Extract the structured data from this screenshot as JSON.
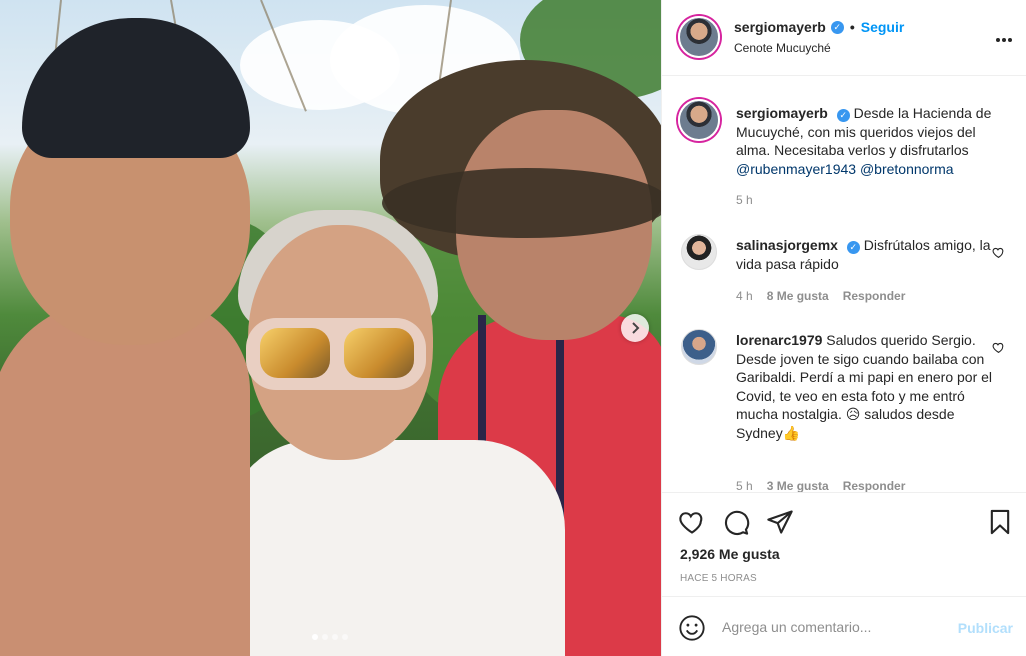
{
  "post": {
    "image_alt": "",
    "carousel": {
      "total": 4,
      "active": 0,
      "next_icon": "chevron-right-icon"
    }
  },
  "header": {
    "username": "sergiomayerb",
    "verified": true,
    "separator": "•",
    "follow_label": "Seguir",
    "location": "Cenote Mucuyché",
    "more_icon": "more-horizontal-icon"
  },
  "caption": {
    "username": "sergiomayerb",
    "text": "Desde la Hacienda de Mucuyché, con mis queridos viejos del alma. Necesitaba verlos y disfrutarlos",
    "mention1": "@rubenmayer1943",
    "mention2": "@bretonnorma",
    "time": "5 h"
  },
  "comments": [
    {
      "username": "salinasjorgemx",
      "verified": true,
      "text": "Disfrútalos amigo, la vida pasa rápido",
      "time": "4 h",
      "likes": "8 Me gusta",
      "reply": "Responder"
    },
    {
      "username": "lorenarc1979",
      "verified": false,
      "text": "Saludos querido Sergio. Desde joven te sigo cuando bailaba con Garibaldi. Perdí a mi papi en enero por el Covid, te veo en esta foto y me entró mucha nostalgia. 😥 saludos desde Sydney👍",
      "time": "5 h",
      "likes": "3 Me gusta",
      "reply": "Responder"
    }
  ],
  "actions": {
    "like_icon": "heart-icon",
    "comment_icon": "comment-icon",
    "share_icon": "paper-plane-icon",
    "save_icon": "bookmark-icon",
    "likes_count": "2,926 Me gusta",
    "timestamp": "HACE 5 HORAS"
  },
  "composer": {
    "emoji_icon": "smiley-icon",
    "placeholder": "Agrega un comentario...",
    "publish_label": "Publicar"
  },
  "colors": {
    "accent": "#0095f6",
    "publish_disabled": "#b2dffc",
    "verified": "#3897f0",
    "muted": "#8e8e8e"
  }
}
